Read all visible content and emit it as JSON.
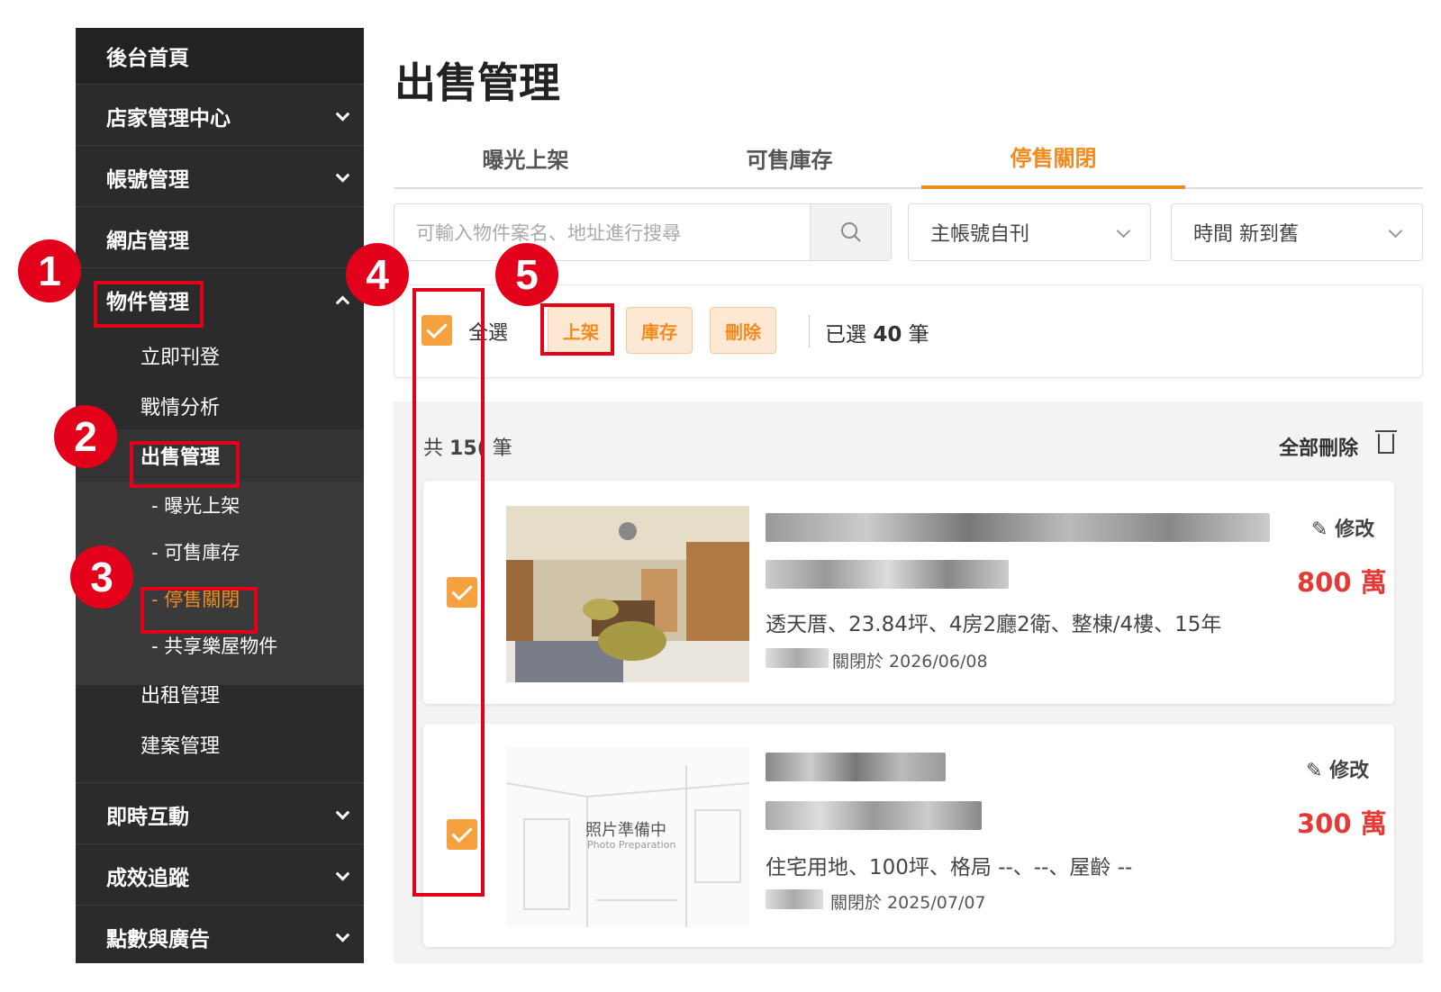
{
  "sidebar": {
    "home": "後台首頁",
    "items": [
      {
        "label": "店家管理中心"
      },
      {
        "label": "帳號管理"
      },
      {
        "label": "網店管理"
      },
      {
        "label": "物件管理"
      },
      {
        "label": "即時互動"
      },
      {
        "label": "成效追蹤"
      },
      {
        "label": "點數與廣告"
      }
    ],
    "sub": {
      "post_now": "立即刊登",
      "analysis": "戰情分析",
      "sale_mgmt": "出售管理",
      "exposed": "- 曝光上架",
      "inventory": "- 可售庫存",
      "stopped": "- 停售關閉",
      "shared": "- 共享樂屋物件",
      "rent_mgmt": "出租管理",
      "project_mgmt": "建案管理"
    }
  },
  "annotations": [
    "1",
    "2",
    "3",
    "4",
    "5"
  ],
  "page": {
    "title": "出售管理",
    "tabs": [
      "曝光上架",
      "可售庫存",
      "停售關閉"
    ],
    "active_tab": "停售關閉"
  },
  "filters": {
    "search_placeholder": "可輸入物件案名、地址進行搜尋",
    "account_select": "主帳號自刊",
    "sort_select": "時間 新到舊"
  },
  "actions": {
    "select_all": "全選",
    "publish": "上架",
    "inventory": "庫存",
    "delete": "刪除",
    "selected_prefix": "已選",
    "selected_count": "40",
    "selected_suffix": "筆"
  },
  "list": {
    "total_prefix": "共",
    "total_count": "15(",
    "total_suffix": "筆",
    "delete_all": "全部刪除",
    "items": [
      {
        "edit": "修改",
        "price": "800 萬",
        "meta": "透天厝、23.84坪、4房2廳2衛、整棟/4樓、15年",
        "closed_on": "關閉於 2026/06/08"
      },
      {
        "edit": "修改",
        "price": "300 萬",
        "meta": "住宅用地、100坪、格局 --、--、屋齡 --",
        "closed_on": "關閉於 2025/07/07",
        "photo_text": "照片準備中",
        "photo_subtext": "Photo Preparation"
      }
    ]
  },
  "colors": {
    "accent": "#f28a1f",
    "annotation_red": "#e3001b",
    "price_red": "#e53935",
    "sidebar_bg": "#2b2b2b"
  }
}
